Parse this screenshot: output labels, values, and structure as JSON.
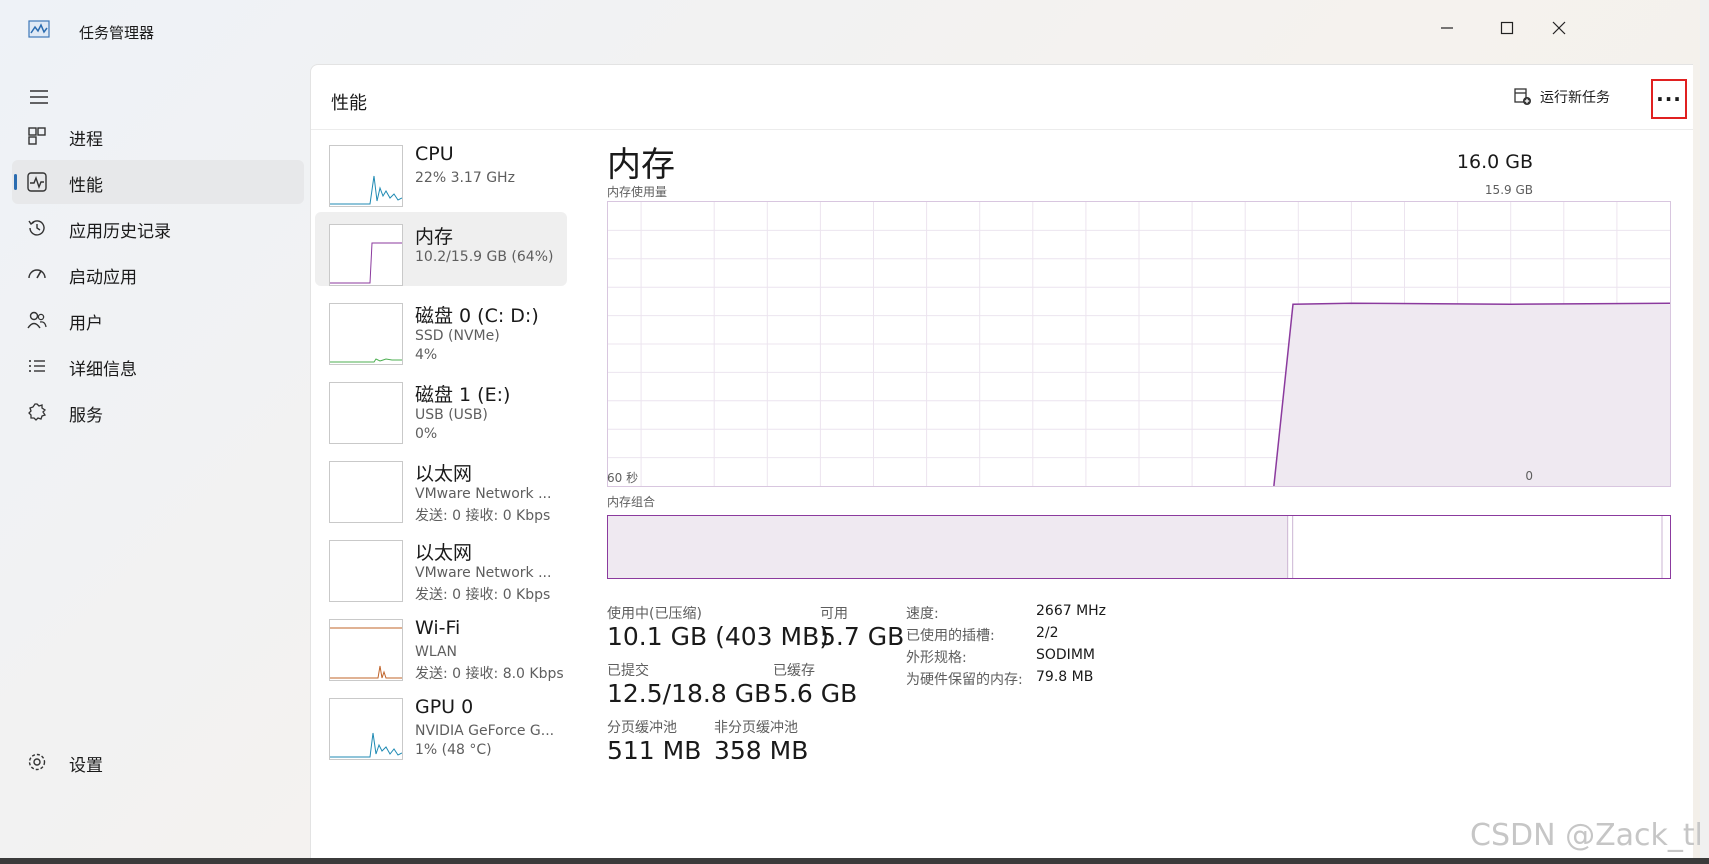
{
  "window": {
    "title": "任务管理器"
  },
  "sidebar": {
    "items": [
      {
        "label": "进程",
        "icon": "grid-icon"
      },
      {
        "label": "性能",
        "icon": "performance-icon",
        "active": true
      },
      {
        "label": "应用历史记录",
        "icon": "history-icon"
      },
      {
        "label": "启动应用",
        "icon": "gauge-icon"
      },
      {
        "label": "用户",
        "icon": "users-icon"
      },
      {
        "label": "详细信息",
        "icon": "list-icon"
      },
      {
        "label": "服务",
        "icon": "services-icon"
      }
    ],
    "settings_label": "设置"
  },
  "header": {
    "title": "性能",
    "run_task_label": "运行新任务",
    "more_label": "···"
  },
  "devices": [
    {
      "name": "CPU",
      "line1": "22% 3.17 GHz",
      "line2": ""
    },
    {
      "name": "内存",
      "line1": "10.2/15.9 GB (64%)",
      "line2": "",
      "active": true
    },
    {
      "name": "磁盘 0 (C: D:)",
      "line1": "SSD (NVMe)",
      "line2": "4%"
    },
    {
      "name": "磁盘 1 (E:)",
      "line1": "USB (USB)",
      "line2": "0%"
    },
    {
      "name": "以太网",
      "line1": "VMware Network ...",
      "line2": "发送: 0 接收: 0 Kbps"
    },
    {
      "name": "以太网",
      "line1": "VMware Network ...",
      "line2": "发送: 0 接收: 0 Kbps"
    },
    {
      "name": "Wi-Fi",
      "line1": "WLAN",
      "line2": "发送: 0 接收: 8.0 Kbps"
    },
    {
      "name": "GPU 0",
      "line1": "NVIDIA GeForce G...",
      "line2": "1% (48 °C)"
    }
  ],
  "memory": {
    "title": "内存",
    "total": "16.0 GB",
    "usage_label": "内存使用量",
    "usage_max": "15.9 GB",
    "time_left": "60 秒",
    "time_right": "0",
    "composition_label": "内存组合",
    "usage_level": 0.64,
    "composition_in_use_fraction": 0.64,
    "stats": {
      "in_use_label": "使用中(已压缩)",
      "in_use_value": "10.1 GB (403 MB)",
      "available_label": "可用",
      "available_value": "5.7 GB",
      "committed_label": "已提交",
      "committed_value": "12.5/18.8 GB",
      "cached_label": "已缓存",
      "cached_value": "5.6 GB",
      "paged_label": "分页缓冲池",
      "paged_value": "511 MB",
      "nonpaged_label": "非分页缓冲池",
      "nonpaged_value": "358 MB"
    },
    "specs": [
      {
        "key": "速度:",
        "value": "2667 MHz"
      },
      {
        "key": "已使用的插槽:",
        "value": "2/2"
      },
      {
        "key": "外形规格:",
        "value": "SODIMM"
      },
      {
        "key": "为硬件保留的内存:",
        "value": "79.8 MB"
      }
    ]
  },
  "colors": {
    "memory": "#8b3a9e",
    "memory_fill": "#efe9f1",
    "accent": "#2b6cb0",
    "cpu": "#1f8ab3",
    "disk": "#4caf50",
    "wifi": "#c0642a"
  },
  "watermark": "CSDN @Zack_th"
}
